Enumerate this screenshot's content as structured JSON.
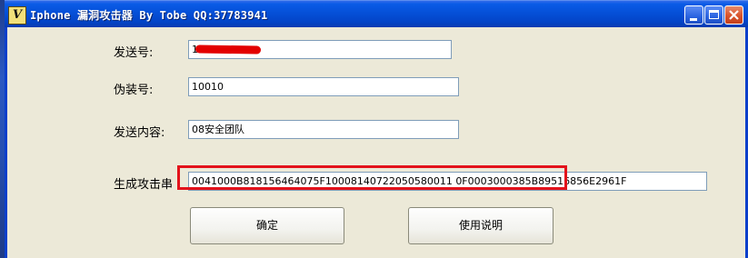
{
  "window": {
    "title": "Iphone 漏洞攻击器 By Tobe QQ:37783941",
    "icon_letter": "V"
  },
  "form": {
    "sender_label": "发送号:",
    "sender_value": "18",
    "disguise_label": "伪装号:",
    "disguise_value": "10010",
    "content_label": "发送内容:",
    "content_value": "08安全团队",
    "attack_label": "生成攻击串",
    "attack_value": "0041000B818156464075F10008140722050580011 0F0003000385B89516856E2961F"
  },
  "buttons": {
    "confirm": "确定",
    "instructions": "使用说明"
  },
  "colors": {
    "titlebar": "#0550d8",
    "window_bg": "#ece9d8",
    "highlight_border": "#e3121b",
    "redaction": "#e30000"
  }
}
